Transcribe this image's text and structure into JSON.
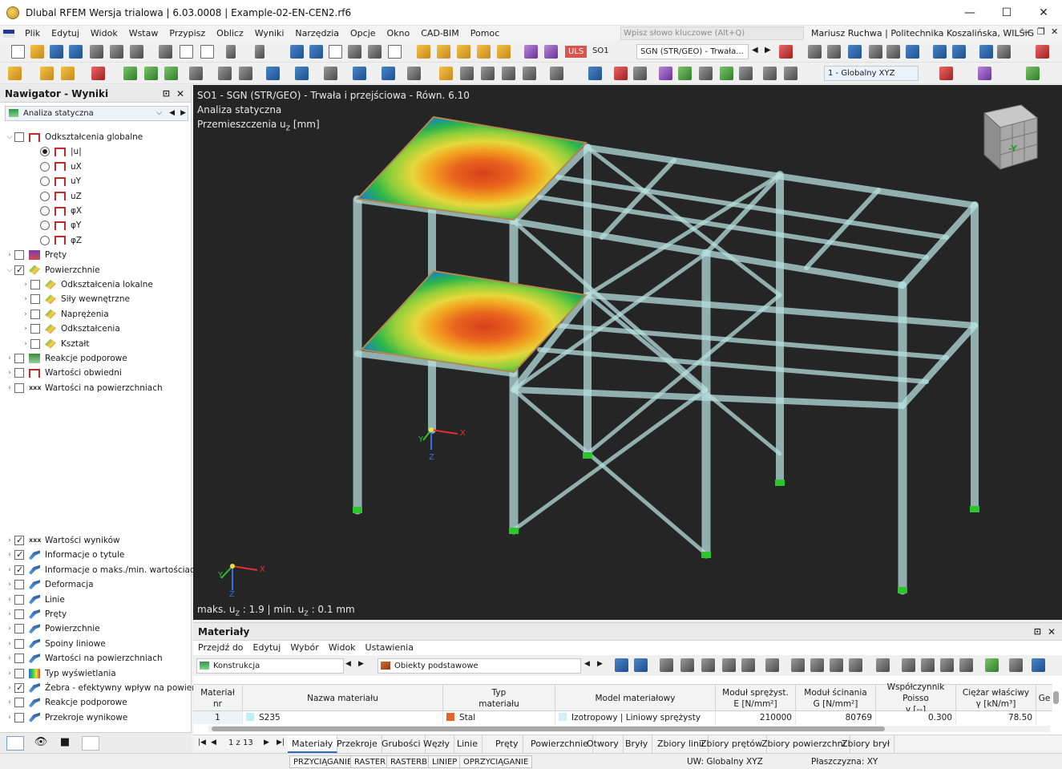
{
  "window": {
    "title": "Dlubal RFEM Wersja trialowa | 6.03.0008 | Example-02-EN-CEN2.rf6",
    "minimize": "—",
    "maximize": "☐",
    "close": "✕"
  },
  "menu": [
    "Plik",
    "Edytuj",
    "Widok",
    "Wstaw",
    "Przypisz",
    "Oblicz",
    "Wyniki",
    "Narzędzia",
    "Opcje",
    "Okno",
    "CAD-BIM",
    "Pomoc"
  ],
  "search": {
    "placeholder": "Wpisz słowo kluczowe (Alt+Q)"
  },
  "user": "Mariusz Ruchwa | Politechnika Koszalińska, WILŚiG",
  "toolbar1": {
    "uls_badge": "ULS",
    "case": "SO1",
    "combo_type": "SGN (STR/GEO) - Trwała..."
  },
  "toolbar2": {
    "coord_system": "1 - Globalny XYZ"
  },
  "navigator": {
    "title": "Nawigator - Wyniki",
    "analysis": "Analiza statyczna",
    "tree": [
      {
        "label": "Odkształcenia globalne",
        "level": 0,
        "checked": false,
        "expanded": true
      },
      {
        "label": "|u|",
        "level": 1,
        "radio": true,
        "selected": true
      },
      {
        "label": "uX",
        "level": 1,
        "radio": true
      },
      {
        "label": "uY",
        "level": 1,
        "radio": true
      },
      {
        "label": "uZ",
        "level": 1,
        "radio": true
      },
      {
        "label": "φX",
        "level": 1,
        "radio": true
      },
      {
        "label": "φY",
        "level": 1,
        "radio": true
      },
      {
        "label": "φZ",
        "level": 1,
        "radio": true
      },
      {
        "label": "Pręty",
        "level": 0,
        "checked": false
      },
      {
        "label": "Powierzchnie",
        "level": 0,
        "checked": true,
        "expanded": true
      },
      {
        "label": "Odkształcenia lokalne",
        "level": 1,
        "checked": false
      },
      {
        "label": "Siły wewnętrzne",
        "level": 1,
        "checked": false
      },
      {
        "label": "Naprężenia",
        "level": 1,
        "checked": false
      },
      {
        "label": "Odkształcenia",
        "level": 1,
        "checked": false
      },
      {
        "label": "Kształt",
        "level": 1,
        "checked": false
      },
      {
        "label": "Reakcje podporowe",
        "level": 0,
        "checked": false
      },
      {
        "label": "Wartości obwiedni",
        "level": 0,
        "checked": false
      },
      {
        "label": "Wartości na powierzchniach",
        "level": 0,
        "checked": false
      }
    ],
    "display": [
      {
        "label": "Wartości wyników",
        "checked": true
      },
      {
        "label": "Informacje o tytule",
        "checked": true
      },
      {
        "label": "Informacje o maks./min. wartościach",
        "checked": true
      },
      {
        "label": "Deformacja",
        "checked": false
      },
      {
        "label": "Linie",
        "checked": false
      },
      {
        "label": "Pręty",
        "checked": false
      },
      {
        "label": "Powierzchnie",
        "checked": false
      },
      {
        "label": "Spoiny liniowe",
        "checked": false
      },
      {
        "label": "Wartości na powierzchniach",
        "checked": false
      },
      {
        "label": "Typ wyświetlania",
        "checked": false
      },
      {
        "label": "Żebra - efektywny wpływ na powier...",
        "checked": true
      },
      {
        "label": "Reakcje podporowe",
        "checked": false
      },
      {
        "label": "Przekroje wynikowe",
        "checked": false
      }
    ]
  },
  "viewport": {
    "line1": "SO1 - SGN (STR/GEO) - Trwała i przejściowa - Równ. 6.10",
    "line2": "Analiza statyczna",
    "line3": "Przemieszczenia u",
    "line3_sub": "Z",
    "line3_unit": " [mm]",
    "max_label": "maks. u",
    "max_sub": "Z",
    "max_value": " : 1.9 | min. u",
    "min_sub": "Z",
    "min_value": " : 0.1 mm",
    "axis_x": "X",
    "axis_y": "Y",
    "axis_z": "Z",
    "cube_label": "-Y"
  },
  "materials": {
    "title": "Materiały",
    "menu": [
      "Przejdź do",
      "Edytuj",
      "Wybór",
      "Widok",
      "Ustawienia"
    ],
    "filter1": "Konstrukcja",
    "filter2": "Obiekty podstawowe",
    "columns": [
      {
        "line1": "Materiał",
        "line2": "nr"
      },
      {
        "line1": "Nazwa materiału",
        "line2": ""
      },
      {
        "line1": "Typ",
        "line2": "materiału"
      },
      {
        "line1": "Model materiałowy",
        "line2": ""
      },
      {
        "line1": "Moduł sprężyst.",
        "line2": "E [N/mm²]"
      },
      {
        "line1": "Moduł ścinania",
        "line2": "G [N/mm²]"
      },
      {
        "line1": "Współczynnik Poisso",
        "line2": "v [--]"
      },
      {
        "line1": "Ciężar właściwy",
        "line2": "γ [kN/m³]"
      },
      {
        "line1": "Ge",
        "line2": ""
      }
    ],
    "row": {
      "nr": "1",
      "name": "S235",
      "type": "Stal",
      "model": "Izotropowy | Liniowy sprężysty",
      "E": "210000",
      "G": "80769",
      "nu": "0.300",
      "gamma": "78.50"
    },
    "pager": "1 z 13",
    "tabs": [
      "Materiały",
      "Przekroje",
      "Grubości",
      "Węzły",
      "Linie",
      "Pręty",
      "Powierzchnie",
      "Otwory",
      "Bryły",
      "Zbiory linii",
      "Zbiory prętów",
      "Zbiory powierzchni",
      "Zbiory brył"
    ]
  },
  "status": {
    "buttons": [
      "PRZYCIĄGANIE",
      "RASTER",
      "RASTERB",
      "LINIEP",
      "OPRZYCIĄGANIE"
    ],
    "cs": "UW: Globalny XYZ",
    "plane": "Płaszczyzna: XY"
  },
  "colors": {
    "viewport_bg": "#252525",
    "accent": "#2a6ac0",
    "uls": "#d9534f"
  }
}
